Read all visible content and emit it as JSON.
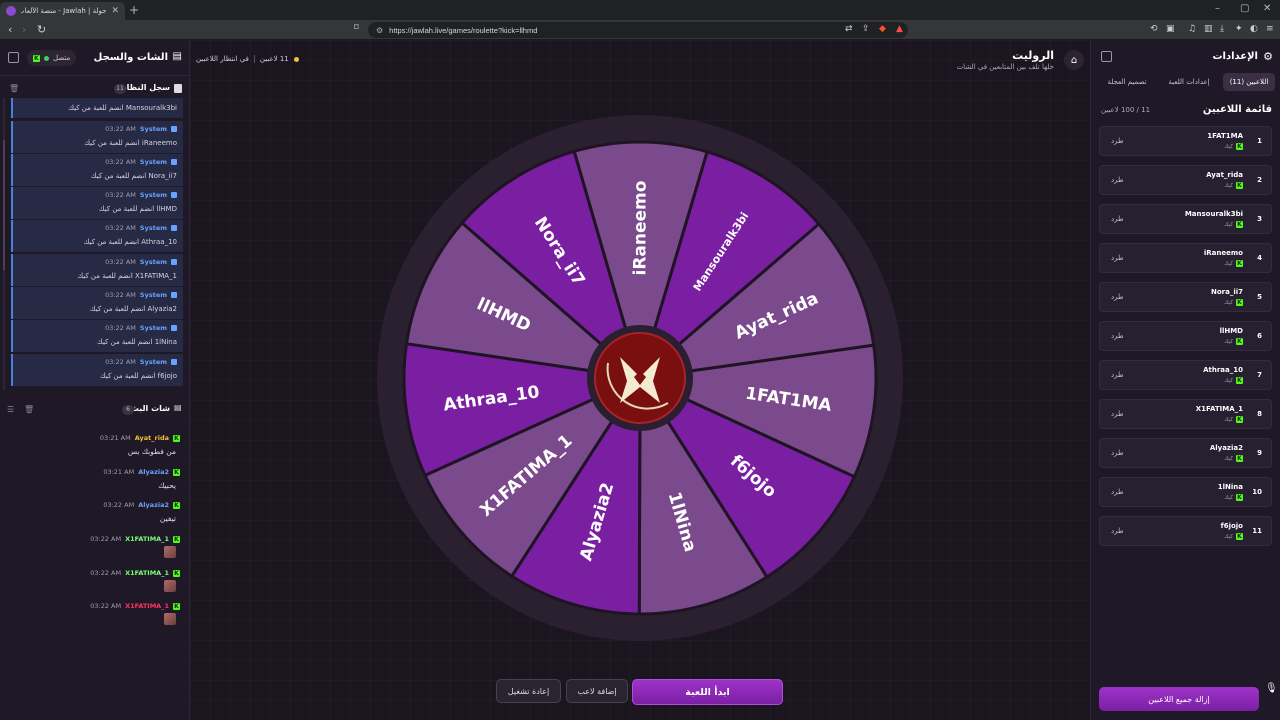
{
  "browser": {
    "tab_title": "جولة | Jawlah - منصة الألعاب التفاعلية",
    "url": "https://jawlah.live/games/roulette?kick=llhmd"
  },
  "colors": {
    "accent": "#8e2ab8",
    "segment_dark": "#7b1fa2",
    "segment_light": "#7a4a8c",
    "kick_green": "#53fc18",
    "system_blue": "#6aa2ff"
  },
  "left_panel": {
    "title": "الشات والسجل",
    "connection_label": "متصل",
    "system_log": {
      "title": "سجل النظام",
      "count": "11",
      "entries": [
        {
          "user": "System",
          "time": "03:22 AM",
          "message": "Mansouralk3bi انضم للعبة من كيك"
        },
        {
          "user": "System",
          "time": "03:22 AM",
          "message": "iRaneemo انضم للعبة من كيك"
        },
        {
          "user": "System",
          "time": "03:22 AM",
          "message": "Nora_ii7 انضم للعبة من كيك"
        },
        {
          "user": "System",
          "time": "03:22 AM",
          "message": "llHMD انضم للعبة من كيك"
        },
        {
          "user": "System",
          "time": "03:22 AM",
          "message": "Athraa_10 انضم للعبة من كيك"
        },
        {
          "user": "System",
          "time": "03:22 AM",
          "message": "X1FATIMA_1 انضم للعبة من كيك"
        },
        {
          "user": "System",
          "time": "03:22 AM",
          "message": "Alyazia2 انضم للعبة من كيك"
        },
        {
          "user": "System",
          "time": "03:22 AM",
          "message": "1lNina انضم للعبة من كيك"
        },
        {
          "user": "System",
          "time": "03:22 AM",
          "message": "f6jojo انضم للعبة من كيك"
        }
      ]
    },
    "live_chat": {
      "title": "شات البث",
      "count": "6",
      "messages": [
        {
          "user": "Ayat_rida",
          "time": "03:21 AM",
          "message": "من فطوبك بس",
          "color": "#f2c232"
        },
        {
          "user": "Alyazia2",
          "time": "03:21 AM",
          "message": "يحبيك",
          "color": "#6aa2ff"
        },
        {
          "user": "Alyazia2",
          "time": "03:22 AM",
          "message": "تيفين",
          "color": "#6aa2ff"
        },
        {
          "user": "X1FATIMA_1",
          "time": "03:22 AM",
          "message": "",
          "color": "#7aff7a"
        },
        {
          "user": "X1FATIMA_1",
          "time": "03:22 AM",
          "message": "",
          "color": "#7aff7a"
        },
        {
          "user": "X1FATIMA_1",
          "time": "03:22 AM",
          "message": "",
          "color": "#ff3366"
        }
      ]
    }
  },
  "center": {
    "game_title": "الروليت",
    "game_subtitle": "خلها تلف بين المتابعين في الشات",
    "players_waiting": "11 لاعبين",
    "waiting_label": "في انتظار اللاعبين",
    "wheel_segments": [
      "1FAT1MA",
      "f6jojo",
      "1lNina",
      "Alyazia2",
      "X1FATIMA_1",
      "Athraa_10",
      "llHMD",
      "Nora_ii7",
      "iRaneemo",
      "Mansouralk3bi",
      "Ayat_rida"
    ],
    "buttons": {
      "start": "ابدأ اللعبة",
      "add_player": "إضافة لاعب",
      "restart": "إعادة تشغيل"
    }
  },
  "right_panel": {
    "title": "الإعدادات",
    "tabs": [
      {
        "label": "اللاعبين (11)",
        "active": true
      },
      {
        "label": "إعدادات اللعبة",
        "active": false
      },
      {
        "label": "تصميم العجلة",
        "active": false
      }
    ],
    "list_title": "قائمة اللاعبين",
    "list_count": "11 / 100 لاعبين",
    "platform_label": "كيك",
    "kick_label": "طرد",
    "players": [
      {
        "num": "1",
        "name": "1FAT1MA"
      },
      {
        "num": "2",
        "name": "Ayat_rida"
      },
      {
        "num": "3",
        "name": "Mansouralk3bi"
      },
      {
        "num": "4",
        "name": "iRaneemo"
      },
      {
        "num": "5",
        "name": "Nora_ii7"
      },
      {
        "num": "6",
        "name": "llHMD"
      },
      {
        "num": "7",
        "name": "Athraa_10"
      },
      {
        "num": "8",
        "name": "X1FATIMA_1"
      },
      {
        "num": "9",
        "name": "Alyazia2"
      },
      {
        "num": "10",
        "name": "1lNina"
      },
      {
        "num": "11",
        "name": "f6jojo"
      }
    ],
    "remove_all": "إزالة جميع اللاعبين"
  }
}
